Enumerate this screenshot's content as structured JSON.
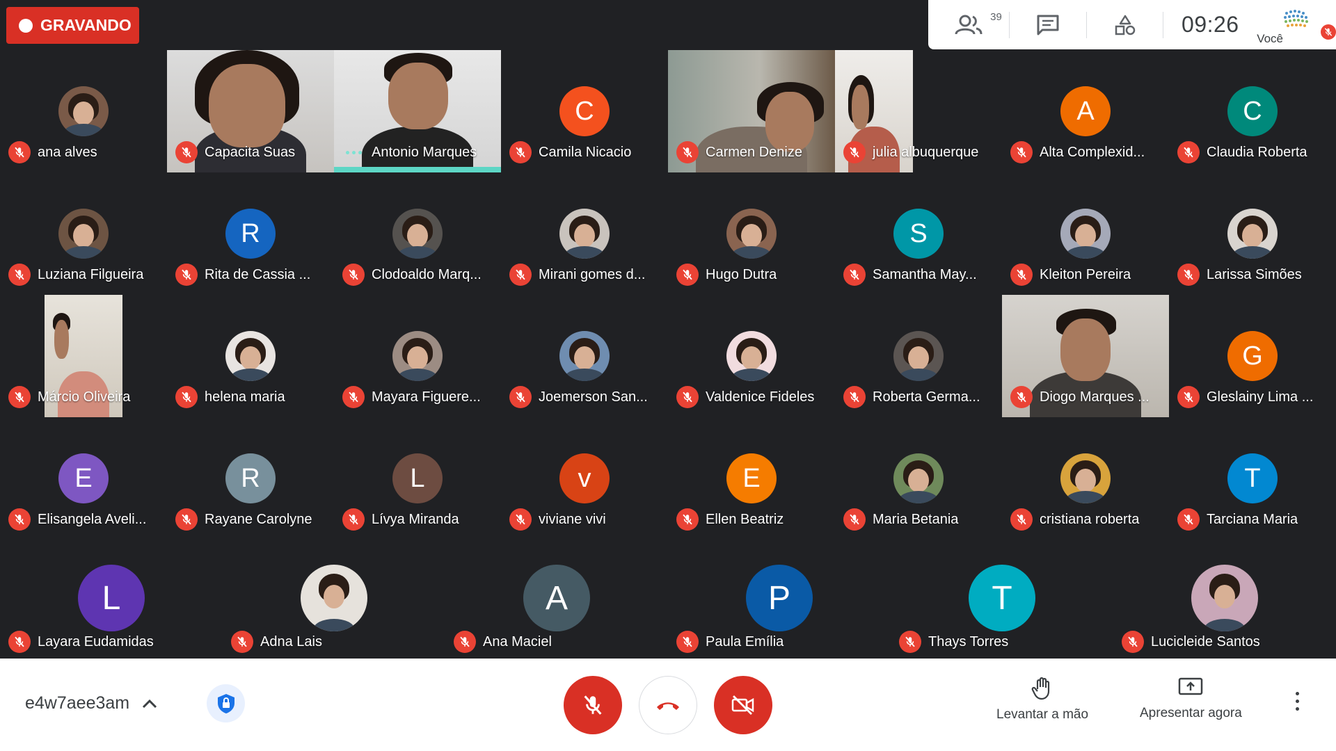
{
  "recording": {
    "label": "GRAVANDO"
  },
  "toolbar": {
    "people_count": "39",
    "time": "09:26",
    "you_label": "Você"
  },
  "participants": [
    {
      "name": "ana alves",
      "kind": "photo",
      "avatar_color": "#7a5a48"
    },
    {
      "name": "Capacita Suas",
      "kind": "video"
    },
    {
      "name": "Antonio Marques",
      "kind": "video",
      "speaking": true
    },
    {
      "name": "Camila Nicacio",
      "kind": "letter",
      "letter": "C",
      "avatar_color": "#f4511e"
    },
    {
      "name": "Carmen Denize",
      "kind": "video"
    },
    {
      "name": "julia albuquerque",
      "kind": "video"
    },
    {
      "name": "Alta Complexid...",
      "kind": "letter",
      "letter": "A",
      "avatar_color": "#ef6c00"
    },
    {
      "name": "Claudia Roberta",
      "kind": "letter",
      "letter": "C",
      "avatar_color": "#00897b"
    },
    {
      "name": "Luziana Filgueira",
      "kind": "photo",
      "avatar_color": "#6d5443"
    },
    {
      "name": "Rita de Cassia ...",
      "kind": "letter",
      "letter": "R",
      "avatar_color": "#1565c0"
    },
    {
      "name": "Clodoaldo Marq...",
      "kind": "photo",
      "avatar_color": "#55524f"
    },
    {
      "name": "Mirani gomes d...",
      "kind": "photo",
      "avatar_color": "#c9c3bd"
    },
    {
      "name": "Hugo Dutra",
      "kind": "photo",
      "avatar_color": "#8a6450"
    },
    {
      "name": "Samantha May...",
      "kind": "letter",
      "letter": "S",
      "avatar_color": "#0097a7"
    },
    {
      "name": "Kleiton Pereira",
      "kind": "photo",
      "avatar_color": "#a5a9b8"
    },
    {
      "name": "Larissa Simões",
      "kind": "photo",
      "avatar_color": "#d9d4cf"
    },
    {
      "name": "Márcio Oliveira",
      "kind": "video"
    },
    {
      "name": "helena maria",
      "kind": "photo",
      "avatar_color": "#e8e4e1"
    },
    {
      "name": "Mayara Figuere...",
      "kind": "photo",
      "avatar_color": "#9c8c83"
    },
    {
      "name": "Joemerson San...",
      "kind": "photo",
      "avatar_color": "#6f8db0"
    },
    {
      "name": "Valdenice Fideles",
      "kind": "photo",
      "avatar_color": "#f1dcdf"
    },
    {
      "name": "Roberta Germa...",
      "kind": "photo",
      "avatar_color": "#5b5552"
    },
    {
      "name": "Diogo Marques ...",
      "kind": "video"
    },
    {
      "name": "Gleslainy Lima ...",
      "kind": "letter",
      "letter": "G",
      "avatar_color": "#ef6c00"
    },
    {
      "name": "Elisangela Aveli...",
      "kind": "letter",
      "letter": "E",
      "avatar_color": "#7e57c2"
    },
    {
      "name": "Rayane Carolyne",
      "kind": "letter",
      "letter": "R",
      "avatar_color": "#78909c"
    },
    {
      "name": "Lívya Miranda",
      "kind": "letter",
      "letter": "L",
      "avatar_color": "#6d4c41"
    },
    {
      "name": "viviane vivi",
      "kind": "letter",
      "letter": "v",
      "avatar_color": "#d84315"
    },
    {
      "name": "Ellen Beatriz",
      "kind": "letter",
      "letter": "E",
      "avatar_color": "#f57c00"
    },
    {
      "name": "Maria Betania",
      "kind": "photo",
      "avatar_color": "#6f8a5b"
    },
    {
      "name": "cristiana roberta",
      "kind": "photo",
      "avatar_color": "#d8a33c"
    },
    {
      "name": "Tarciana Maria",
      "kind": "letter",
      "letter": "T",
      "avatar_color": "#0288d1"
    },
    {
      "name": "Layara Eudamidas",
      "kind": "letter",
      "letter": "L",
      "avatar_color": "#5e35b1"
    },
    {
      "name": "Adna Lais",
      "kind": "photo",
      "avatar_color": "#e6e2dc"
    },
    {
      "name": "Ana Maciel",
      "kind": "letter",
      "letter": "A",
      "avatar_color": "#455a64"
    },
    {
      "name": "Paula Emília",
      "kind": "letter",
      "letter": "P",
      "avatar_color": "#0a5aa6"
    },
    {
      "name": "Thays Torres",
      "kind": "letter",
      "letter": "T",
      "avatar_color": "#00acc1"
    },
    {
      "name": "Lucicleide Santos",
      "kind": "photo",
      "avatar_color": "#c9a7b8"
    }
  ],
  "bottom": {
    "meeting_code": "e4w7aee3am",
    "raise_hand_label": "Levantar a mão",
    "present_label": "Apresentar agora"
  },
  "colors": {
    "mic_off": "#ea4335",
    "end_call": "#d93025",
    "speaking": "#5dd6c5"
  }
}
